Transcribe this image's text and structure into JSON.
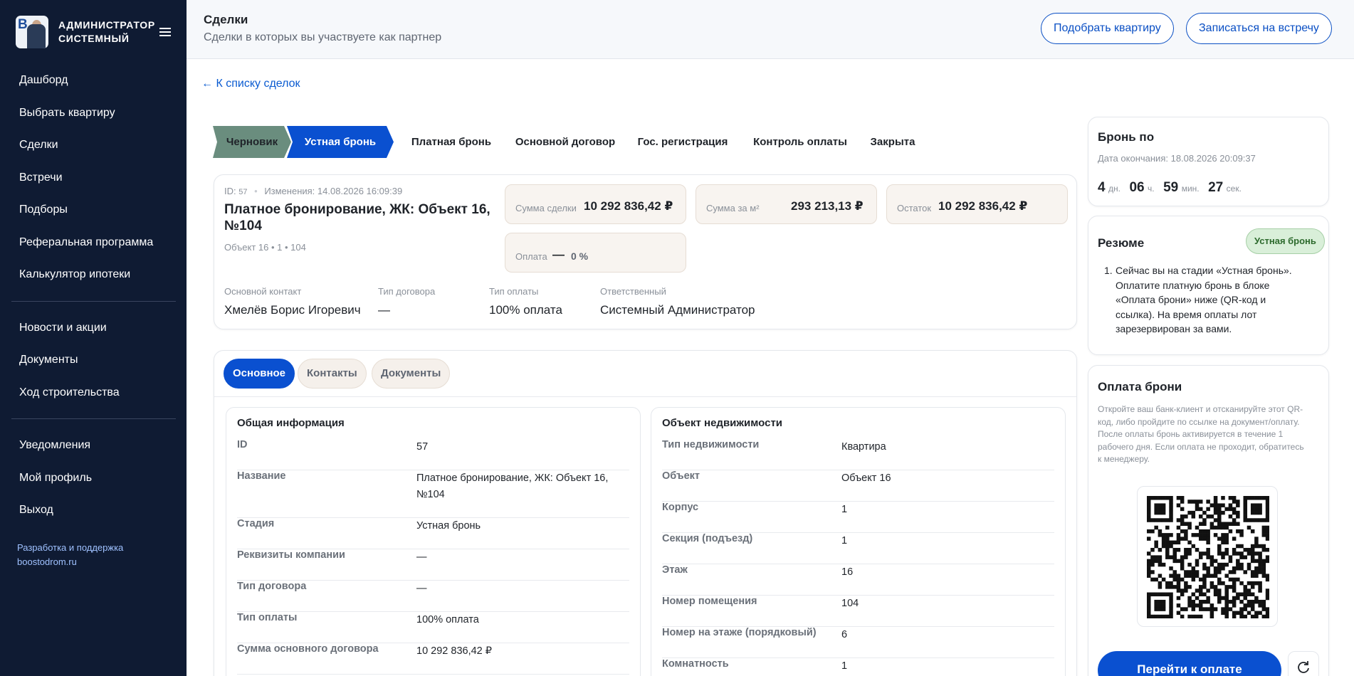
{
  "sidebar": {
    "user": {
      "line1": "АДМИНИСТРАТОР",
      "line2": "СИСТЕМНЫЙ"
    },
    "nav_primary": [
      {
        "label": "Дашборд"
      },
      {
        "label": "Выбрать квартиру"
      },
      {
        "label": "Сделки"
      },
      {
        "label": "Встречи"
      },
      {
        "label": "Подборы"
      },
      {
        "label": "Реферальная программа"
      },
      {
        "label": "Калькулятор ипотеки"
      }
    ],
    "nav_secondary": [
      {
        "label": "Новости и акции"
      },
      {
        "label": "Документы"
      },
      {
        "label": "Ход строительства"
      }
    ],
    "nav_tertiary": [
      {
        "label": "Уведомления"
      },
      {
        "label": "Мой профиль"
      },
      {
        "label": "Выход"
      }
    ],
    "footer": {
      "line1": "Разработка и поддержка",
      "line2": "boostodrom.ru"
    }
  },
  "header": {
    "title": "Сделки",
    "subtitle": "Сделки в которых вы участвуете как партнер",
    "btn_pick": "Подобрать квартиру",
    "btn_meeting": "Записаться на встречу"
  },
  "back_link": "← К списку сделок",
  "stages": [
    {
      "label": "Черновик",
      "state": "done"
    },
    {
      "label": "Устная бронь",
      "state": "active"
    },
    {
      "label": "Платная бронь",
      "state": "todo"
    },
    {
      "label": "Основной договор",
      "state": "todo"
    },
    {
      "label": "Гос. регистрация",
      "state": "todo"
    },
    {
      "label": "Контроль оплаты",
      "state": "todo"
    },
    {
      "label": "Закрыта",
      "state": "todo"
    }
  ],
  "deal": {
    "id_label": "ID:",
    "id_value": "57",
    "dot": "•",
    "changes_label": "Изменения:",
    "changes_value": "14.08.2026 16:09:39",
    "title_line1": "Платное бронирование, ЖК: Объект 16,",
    "title_line2": "№104",
    "subtitle": "Объект 16 • 1 • 104",
    "sum_label": "Сумма сделки",
    "sum_value": "10 292 836,42 ₽",
    "sqm_label": "Сумма за м²",
    "sqm_value": "293 213,13 ₽",
    "rest_label": "Остаток",
    "rest_value": "10 292 836,42 ₽",
    "pay_label": "Оплата",
    "pay_dash": "—",
    "pay_value": "0 %",
    "contact_label": "Основной контакт",
    "contact_value": "Хмелёв Борис Игоревич",
    "contract_label": "Тип договора",
    "contract_value": "—",
    "paytype_label": "Тип оплаты",
    "paytype_value": "100% оплата",
    "resp_label": "Ответственный",
    "resp_value": "Системный Администратор"
  },
  "tabs": {
    "main": "Основное",
    "contacts": "Контакты",
    "docs": "Документы"
  },
  "general": {
    "title": "Общая информация",
    "rows": [
      {
        "k": "ID",
        "v": "57"
      },
      {
        "k": "Название",
        "v1": "Платное бронирование, ЖК: Объект 16,",
        "v2": "№104"
      },
      {
        "k": "Стадия",
        "v": "Устная бронь"
      },
      {
        "k": "Реквизиты компании",
        "v": "—"
      },
      {
        "k": "Тип договора",
        "v": "—"
      },
      {
        "k": "Тип оплаты",
        "v": "100% оплата"
      },
      {
        "k": "Сумма основного договора",
        "v": "10 292 836,42 ₽"
      }
    ]
  },
  "property": {
    "title": "Объект недвижимости",
    "rows": [
      {
        "k": "Тип недвижимости",
        "v": "Квартира"
      },
      {
        "k": "Объект",
        "v": "Объект 16"
      },
      {
        "k": "Корпус",
        "v": "1"
      },
      {
        "k": "Секция (подъезд)",
        "v": "1"
      },
      {
        "k": "Этаж",
        "v": "16"
      },
      {
        "k": "Номер помещения",
        "v": "104"
      },
      {
        "k": "Номер на этаже (порядковый)",
        "v": "6"
      },
      {
        "k": "Комнатность",
        "v": "1"
      }
    ]
  },
  "booking": {
    "title": "Бронь по",
    "end_label": "Дата окончания:",
    "end_value": "18.08.2026 20:09:37",
    "days": "4",
    "days_u": "дн.",
    "hours": "06",
    "hours_u": "ч.",
    "mins": "59",
    "mins_u": "мин.",
    "secs": "27",
    "secs_u": "сек."
  },
  "resume": {
    "title": "Резюме",
    "badge": "Устная бронь",
    "item_num": "1.",
    "item_lines": [
      "Сейчас вы на стадии «Устная бронь».",
      "Оплатите платную бронь в блоке",
      "«Оплата брони» ниже (QR-код и",
      "ссылка). На время оплаты лот",
      "зарезервирован за вами."
    ]
  },
  "payment": {
    "title": "Оплата брони",
    "desc_lines": [
      "Откройте ваш банк-клиент и отсканируйте этот QR-",
      "код, либо пройдите по ссылке на документ/оплату.",
      "После оплаты бронь активируется в течение 1",
      "рабочего дня. Если оплата не проходит, обратитесь",
      "к менеджеру."
    ],
    "button": "Перейти к оплате"
  },
  "colors": {
    "sidebar": "#0f1b33",
    "accent": "#0a50d0",
    "stage_done": "#6a8d7e",
    "badge_bg": "#d9efd9"
  }
}
